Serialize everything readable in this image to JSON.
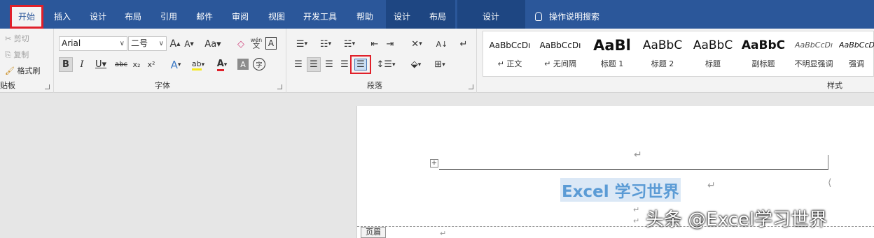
{
  "tabs": {
    "home": "开始",
    "insert": "插入",
    "design": "设计",
    "layout": "布局",
    "references": "引用",
    "mailings": "邮件",
    "review": "审阅",
    "view": "视图",
    "developer": "开发工具",
    "help": "帮助",
    "ctx_design": "设计",
    "ctx_layout": "布局",
    "hf_design": "设计"
  },
  "tell_me": "操作说明搜索",
  "clipboard": {
    "cut": "剪切",
    "copy": "复制",
    "format_painter": "格式刷",
    "label": "贴板"
  },
  "font": {
    "name": "Arial",
    "size": "二号",
    "label": "字体",
    "aa": "Aa",
    "grow": "A",
    "shrink": "A",
    "wen": "wén",
    "wen2": "文",
    "bold": "B",
    "italic": "I",
    "underline": "U",
    "strike": "abc",
    "sub": "x₂",
    "sup": "x²",
    "effects": "A",
    "color": "A",
    "shade": "A",
    "circle": "字"
  },
  "paragraph": {
    "label": "段落"
  },
  "styles": {
    "label": "样式",
    "items": [
      {
        "sample": "AaBbCcDı",
        "name": "↵ 正文"
      },
      {
        "sample": "AaBbCcDı",
        "name": "↵ 无间隔"
      },
      {
        "sample": "AaBl",
        "name": "标题 1"
      },
      {
        "sample": "AaBbC",
        "name": "标题 2"
      },
      {
        "sample": "AaBbC",
        "name": "标题"
      },
      {
        "sample": "AaBbC",
        "name": "副标题"
      },
      {
        "sample": "AaBbCcDı",
        "name": "不明显强调"
      },
      {
        "sample": "AaBbCcDa",
        "name": "强调"
      }
    ]
  },
  "document": {
    "title": "Excel 学习世界",
    "header_tab": "页眉",
    "watermark": "头条 @Excel学习世界",
    "return_mark": "↵",
    "left_mark": "⟨"
  },
  "colors": {
    "brand": "#2b579a",
    "highlight": "#e0202a",
    "title": "#5b9bd5"
  }
}
